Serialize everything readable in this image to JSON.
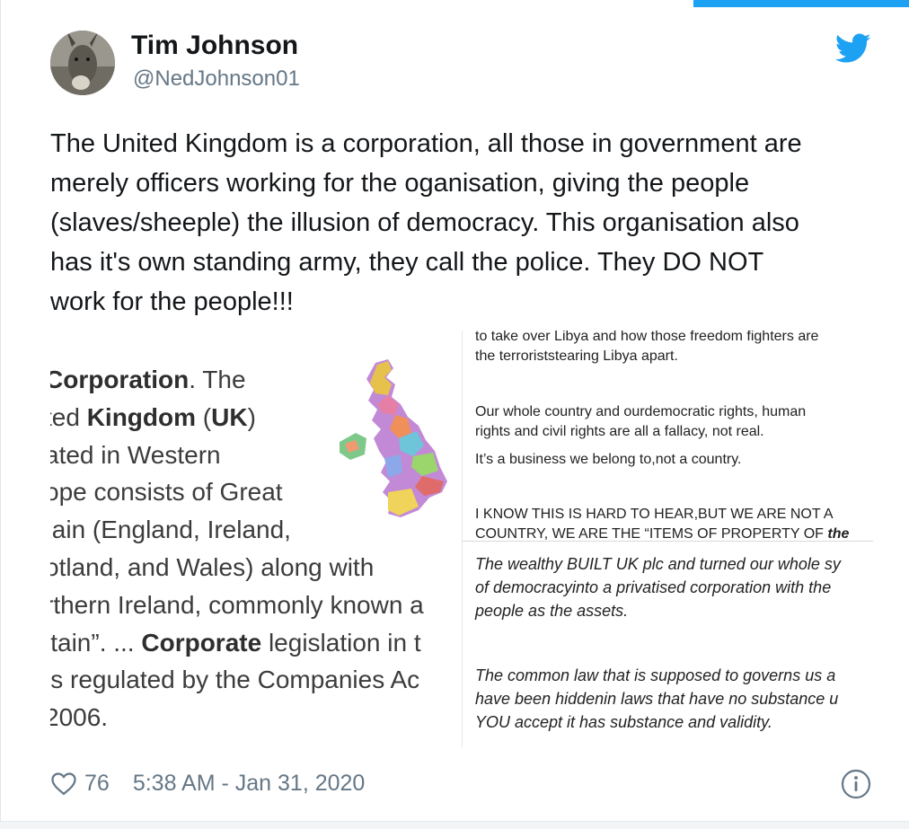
{
  "author": {
    "name": "Tim Johnson",
    "handle": "@NedJohnson01"
  },
  "tweet": {
    "text": "The United Kingdom is a corporation, all those in government are\nmerely officers working for the oganisation, giving the people\n(slaves/sheeple) the illusion of democracy. This organisation also\nhas it's own standing army, they call the police. They DO NOT\nwork for the people!!!"
  },
  "media": {
    "left": {
      "lines": [
        {
          "bold": "Corporation",
          "rest": ". The"
        },
        {
          "pre": "ted ",
          "bold": "Kingdom",
          "mid": " (",
          "bold2": "UK",
          "rest": ")"
        },
        {
          "text": "ated in Western"
        },
        {
          "text": "ope consists of Great"
        },
        {
          "text": ":ain (England, Ireland,"
        },
        {
          "text": "otland, and Wales) along with"
        },
        {
          "text": "rthern Ireland, commonly known a"
        },
        {
          "pre": "itain”. ... ",
          "bold": "Corporate",
          "rest": " legislation in t"
        },
        {
          "text": " is regulated by the Companies Ac"
        },
        {
          "text": "2006."
        }
      ]
    },
    "right_top": {
      "cut_line": "to take over Libya and how those freedom fighters are",
      "line1": "the terroriststearing Libya apart.",
      "line2": "Our whole country and ourdemocratic rights, human",
      "line3": "rights and civil rights are all a fallacy, not real.",
      "line4": "It’s a business we belong to,not a country.",
      "line5": "I KNOW THIS IS HARD TO HEAR,BUT WE ARE NOT A",
      "line6a": "COUNTRY, WE ARE THE “ITEMS OF PROPERTY OF ",
      "line6b": "the"
    },
    "right_bottom": {
      "line1": "The wealthy BUILT UK plc and turned our whole sy",
      "line2": "of democracyinto a privatised corporation with the",
      "line3": "people as the assets.",
      "line4": "The common law that is supposed to governs us a",
      "line5": "have been hiddenin laws that have no substance u",
      "line6": "YOU accept it has substance and validity."
    }
  },
  "footer": {
    "likes": "76",
    "timestamp": "5:38 AM - Jan 31, 2020"
  },
  "icons": {
    "bird": "twitter-bird-icon",
    "heart": "heart-icon",
    "info": "info-icon"
  },
  "colors": {
    "twitter_blue": "#1da1f2",
    "secondary_text": "#657786"
  }
}
